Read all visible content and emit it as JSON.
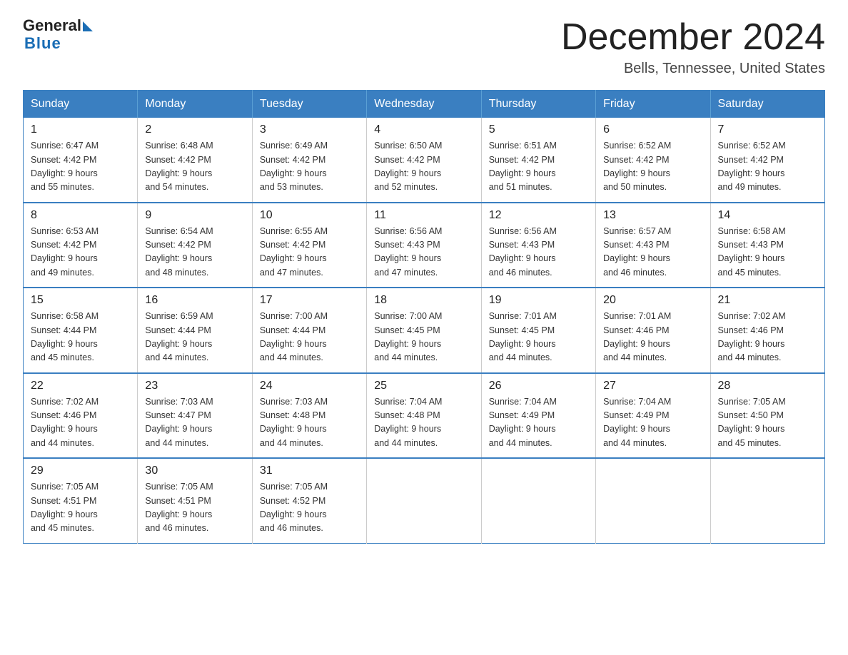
{
  "logo": {
    "part1": "General",
    "part2": "Blue"
  },
  "header": {
    "month_year": "December 2024",
    "location": "Bells, Tennessee, United States"
  },
  "days_of_week": [
    "Sunday",
    "Monday",
    "Tuesday",
    "Wednesday",
    "Thursday",
    "Friday",
    "Saturday"
  ],
  "weeks": [
    [
      {
        "day": "1",
        "sunrise": "6:47 AM",
        "sunset": "4:42 PM",
        "daylight": "9 hours and 55 minutes."
      },
      {
        "day": "2",
        "sunrise": "6:48 AM",
        "sunset": "4:42 PM",
        "daylight": "9 hours and 54 minutes."
      },
      {
        "day": "3",
        "sunrise": "6:49 AM",
        "sunset": "4:42 PM",
        "daylight": "9 hours and 53 minutes."
      },
      {
        "day": "4",
        "sunrise": "6:50 AM",
        "sunset": "4:42 PM",
        "daylight": "9 hours and 52 minutes."
      },
      {
        "day": "5",
        "sunrise": "6:51 AM",
        "sunset": "4:42 PM",
        "daylight": "9 hours and 51 minutes."
      },
      {
        "day": "6",
        "sunrise": "6:52 AM",
        "sunset": "4:42 PM",
        "daylight": "9 hours and 50 minutes."
      },
      {
        "day": "7",
        "sunrise": "6:52 AM",
        "sunset": "4:42 PM",
        "daylight": "9 hours and 49 minutes."
      }
    ],
    [
      {
        "day": "8",
        "sunrise": "6:53 AM",
        "sunset": "4:42 PM",
        "daylight": "9 hours and 49 minutes."
      },
      {
        "day": "9",
        "sunrise": "6:54 AM",
        "sunset": "4:42 PM",
        "daylight": "9 hours and 48 minutes."
      },
      {
        "day": "10",
        "sunrise": "6:55 AM",
        "sunset": "4:42 PM",
        "daylight": "9 hours and 47 minutes."
      },
      {
        "day": "11",
        "sunrise": "6:56 AM",
        "sunset": "4:43 PM",
        "daylight": "9 hours and 47 minutes."
      },
      {
        "day": "12",
        "sunrise": "6:56 AM",
        "sunset": "4:43 PM",
        "daylight": "9 hours and 46 minutes."
      },
      {
        "day": "13",
        "sunrise": "6:57 AM",
        "sunset": "4:43 PM",
        "daylight": "9 hours and 46 minutes."
      },
      {
        "day": "14",
        "sunrise": "6:58 AM",
        "sunset": "4:43 PM",
        "daylight": "9 hours and 45 minutes."
      }
    ],
    [
      {
        "day": "15",
        "sunrise": "6:58 AM",
        "sunset": "4:44 PM",
        "daylight": "9 hours and 45 minutes."
      },
      {
        "day": "16",
        "sunrise": "6:59 AM",
        "sunset": "4:44 PM",
        "daylight": "9 hours and 44 minutes."
      },
      {
        "day": "17",
        "sunrise": "7:00 AM",
        "sunset": "4:44 PM",
        "daylight": "9 hours and 44 minutes."
      },
      {
        "day": "18",
        "sunrise": "7:00 AM",
        "sunset": "4:45 PM",
        "daylight": "9 hours and 44 minutes."
      },
      {
        "day": "19",
        "sunrise": "7:01 AM",
        "sunset": "4:45 PM",
        "daylight": "9 hours and 44 minutes."
      },
      {
        "day": "20",
        "sunrise": "7:01 AM",
        "sunset": "4:46 PM",
        "daylight": "9 hours and 44 minutes."
      },
      {
        "day": "21",
        "sunrise": "7:02 AM",
        "sunset": "4:46 PM",
        "daylight": "9 hours and 44 minutes."
      }
    ],
    [
      {
        "day": "22",
        "sunrise": "7:02 AM",
        "sunset": "4:46 PM",
        "daylight": "9 hours and 44 minutes."
      },
      {
        "day": "23",
        "sunrise": "7:03 AM",
        "sunset": "4:47 PM",
        "daylight": "9 hours and 44 minutes."
      },
      {
        "day": "24",
        "sunrise": "7:03 AM",
        "sunset": "4:48 PM",
        "daylight": "9 hours and 44 minutes."
      },
      {
        "day": "25",
        "sunrise": "7:04 AM",
        "sunset": "4:48 PM",
        "daylight": "9 hours and 44 minutes."
      },
      {
        "day": "26",
        "sunrise": "7:04 AM",
        "sunset": "4:49 PM",
        "daylight": "9 hours and 44 minutes."
      },
      {
        "day": "27",
        "sunrise": "7:04 AM",
        "sunset": "4:49 PM",
        "daylight": "9 hours and 44 minutes."
      },
      {
        "day": "28",
        "sunrise": "7:05 AM",
        "sunset": "4:50 PM",
        "daylight": "9 hours and 45 minutes."
      }
    ],
    [
      {
        "day": "29",
        "sunrise": "7:05 AM",
        "sunset": "4:51 PM",
        "daylight": "9 hours and 45 minutes."
      },
      {
        "day": "30",
        "sunrise": "7:05 AM",
        "sunset": "4:51 PM",
        "daylight": "9 hours and 46 minutes."
      },
      {
        "day": "31",
        "sunrise": "7:05 AM",
        "sunset": "4:52 PM",
        "daylight": "9 hours and 46 minutes."
      },
      null,
      null,
      null,
      null
    ]
  ],
  "labels": {
    "sunrise": "Sunrise:",
    "sunset": "Sunset:",
    "daylight": "Daylight:"
  }
}
